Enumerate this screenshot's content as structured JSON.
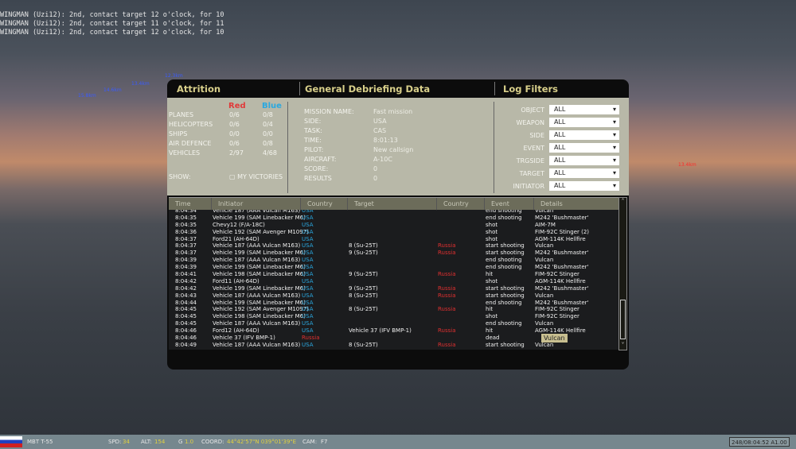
{
  "chat": [
    "WINGMAN (Uzi12): 2nd, contact target 12 o'clock, for 10",
    "WINGMAN (Uzi12): 2nd, contact target 11 o'clock, for 11",
    "WINGMAN (Uzi12): 2nd, contact target 12 o'clock, for 10"
  ],
  "scene_labels": [
    "12.3km",
    "13.4km",
    "14.6km",
    "15.8km",
    "13.4km"
  ],
  "headers": {
    "attrition": "Attrition",
    "general": "General Debriefing Data",
    "filters": "Log Filters"
  },
  "attrition": {
    "red": "Red",
    "blue": "Blue",
    "red_color": "#e03a3a",
    "blue_color": "#2aa8e0",
    "rows": [
      {
        "label": "PLANES",
        "red": "0/6",
        "blue": "0/8"
      },
      {
        "label": "HELICOPTERS",
        "red": "0/6",
        "blue": "0/4"
      },
      {
        "label": "SHIPS",
        "red": "0/0",
        "blue": "0/0"
      },
      {
        "label": "AIR DEFENCE",
        "red": "0/6",
        "blue": "0/8"
      },
      {
        "label": "VEHICLES",
        "red": "2/97",
        "blue": "4/68"
      }
    ],
    "show_label": "SHOW:",
    "my_victories": "MY VICTORIES",
    "my_victories_checked": false
  },
  "general": [
    {
      "k": "MISSION NAME:",
      "v": "Fast mission"
    },
    {
      "k": "SIDE:",
      "v": "USA"
    },
    {
      "k": "TASK:",
      "v": "CAS"
    },
    {
      "k": "TIME:",
      "v": "8:01:13"
    },
    {
      "k": "PILOT:",
      "v": "New callsign"
    },
    {
      "k": "AIRCRAFT:",
      "v": "A-10C"
    },
    {
      "k": "SCORE:",
      "v": "0"
    },
    {
      "k": "RESULTS",
      "v": "0"
    }
  ],
  "filters": [
    {
      "label": "OBJECT",
      "value": "ALL"
    },
    {
      "label": "WEAPON",
      "value": "ALL"
    },
    {
      "label": "SIDE",
      "value": "ALL"
    },
    {
      "label": "EVENT",
      "value": "ALL"
    },
    {
      "label": "TRGSIDE",
      "value": "ALL"
    },
    {
      "label": "TARGET",
      "value": "ALL"
    },
    {
      "label": "INITIATOR",
      "value": "ALL"
    }
  ],
  "log_columns": [
    "Time",
    "Initiator",
    "Country",
    "Target",
    "Country",
    "Event",
    "Details"
  ],
  "log": [
    [
      "8:04:34",
      "Vehicle 187 (AAA Vulcan M163)",
      "USA",
      "",
      "",
      "end shooting",
      "Vulcan"
    ],
    [
      "8:04:35",
      "Vehicle 199 (SAM Linebacker M6)",
      "USA",
      "",
      "",
      "end shooting",
      "M242 'Bushmaster'"
    ],
    [
      "8:04:35",
      "Chevy12 (F/A-18C)",
      "USA",
      "",
      "",
      "shot",
      "AIM-7M"
    ],
    [
      "8:04:36",
      "Vehicle 192 (SAM Avenger M1097)",
      "USA",
      "",
      "",
      "shot",
      "FIM-92C Stinger (2)"
    ],
    [
      "8:04:37",
      "Ford21 (AH-64D)",
      "USA",
      "",
      "",
      "shot",
      "AGM-114K Hellfire"
    ],
    [
      "8:04:37",
      "Vehicle 187 (AAA Vulcan M163)",
      "USA",
      "8 (Su-25T)",
      "Russia",
      "start shooting",
      "Vulcan"
    ],
    [
      "8:04:37",
      "Vehicle 199 (SAM Linebacker M6)",
      "USA",
      "9 (Su-25T)",
      "Russia",
      "start shooting",
      "M242 'Bushmaster'"
    ],
    [
      "8:04:39",
      "Vehicle 187 (AAA Vulcan M163)",
      "USA",
      "",
      "",
      "end shooting",
      "Vulcan"
    ],
    [
      "8:04:39",
      "Vehicle 199 (SAM Linebacker M6)",
      "USA",
      "",
      "",
      "end shooting",
      "M242 'Bushmaster'"
    ],
    [
      "8:04:41",
      "Vehicle 198 (SAM Linebacker M6)",
      "USA",
      "9 (Su-25T)",
      "Russia",
      "hit",
      "FIM-92C Stinger"
    ],
    [
      "8:04:42",
      "Ford11 (AH-64D)",
      "USA",
      "",
      "",
      "shot",
      "AGM-114K Hellfire"
    ],
    [
      "8:04:42",
      "Vehicle 199 (SAM Linebacker M6)",
      "USA",
      "9 (Su-25T)",
      "Russia",
      "start shooting",
      "M242 'Bushmaster'"
    ],
    [
      "8:04:43",
      "Vehicle 187 (AAA Vulcan M163)",
      "USA",
      "8 (Su-25T)",
      "Russia",
      "start shooting",
      "Vulcan"
    ],
    [
      "8:04:44",
      "Vehicle 199 (SAM Linebacker M6)",
      "USA",
      "",
      "",
      "end shooting",
      "M242 'Bushmaster'"
    ],
    [
      "8:04:45",
      "Vehicle 192 (SAM Avenger M1097)",
      "USA",
      "8 (Su-25T)",
      "Russia",
      "hit",
      "FIM-92C Stinger"
    ],
    [
      "8:04:45",
      "Vehicle 198 (SAM Linebacker M6)",
      "USA",
      "",
      "",
      "shot",
      "FIM-92C Stinger"
    ],
    [
      "8:04:45",
      "Vehicle 187 (AAA Vulcan M163)",
      "USA",
      "",
      "",
      "end shooting",
      "Vulcan"
    ],
    [
      "8:04:46",
      "Ford12 (AH-64D)",
      "USA",
      "Vehicle 37 (IFV BMP-1)",
      "Russia",
      "hit",
      "AGM-114K Hellfire"
    ],
    [
      "8:04:46",
      "Vehicle 37 (IFV BMP-1)",
      "Russia",
      "",
      "",
      "dead",
      ""
    ],
    [
      "8:04:49",
      "Vehicle 187 (AAA Vulcan M163)",
      "USA",
      "8 (Su-25T)",
      "Russia",
      "start shooting",
      "Vulcan"
    ]
  ],
  "tooltip": "Vulcan",
  "status": {
    "unit": "MBT T-55",
    "spd_label": "SPD:",
    "spd": "34",
    "alt_label": "ALT:",
    "alt": "154",
    "g_label": "G",
    "g": "1.0",
    "coord_label": "COORD:",
    "coord": "44°42'57\"N 039°01'39\"E",
    "cam_label": "CAM:",
    "cam": "F7",
    "clock": "248/08:04:52 A1.00"
  }
}
